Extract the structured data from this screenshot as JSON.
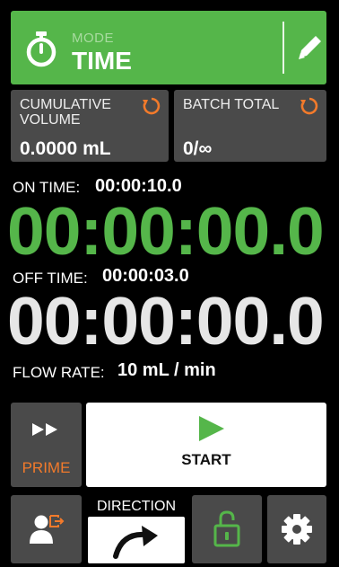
{
  "mode": {
    "label": "MODE",
    "value": "TIME",
    "icon": "stopwatch-icon",
    "edit_icon": "pencil-icon"
  },
  "counters": {
    "cumulative": {
      "label_line1": "CUMULATIVE",
      "label_line2": "VOLUME",
      "value": "0.0000 mL",
      "icon": "reset-icon"
    },
    "batch": {
      "label": "BATCH TOTAL",
      "value": "0/∞",
      "icon": "reset-icon"
    }
  },
  "timers": {
    "on": {
      "label": "ON TIME:",
      "setpoint": "00:00:10.0",
      "counter": "00:00:00.0"
    },
    "off": {
      "label": "OFF TIME:",
      "setpoint": "00:00:03.0",
      "counter": "00:00:00.0"
    }
  },
  "flow": {
    "label": "FLOW RATE:",
    "value": "10 mL / min"
  },
  "controls": {
    "prime": {
      "label": "PRIME",
      "icon": "fast-forward-icon"
    },
    "start": {
      "label": "START",
      "icon": "play-icon"
    },
    "user": {
      "icon": "user-logout-icon"
    },
    "direction": {
      "label": "DIRECTION",
      "icon": "clockwise-arrow-icon"
    },
    "lock": {
      "icon": "unlock-icon"
    },
    "settings": {
      "icon": "gear-icon"
    }
  },
  "colors": {
    "accent": "#55b64a",
    "panel": "#4a4a4a",
    "prime": "#f27a2b",
    "reset": "#f27a2b"
  }
}
